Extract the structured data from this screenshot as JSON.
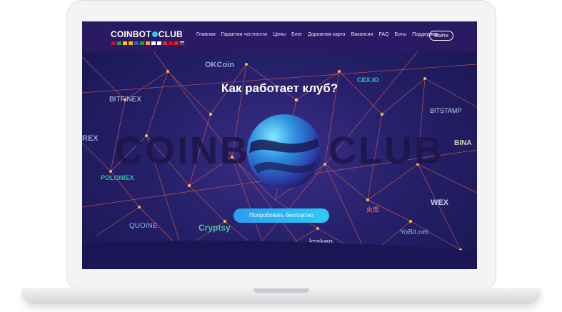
{
  "brand": {
    "logo_left": "COINBOT",
    "logo_right": "CLUB"
  },
  "languages": [
    {
      "name": "uk",
      "color": "#c8102e"
    },
    {
      "name": "br",
      "color": "#2d9b3a"
    },
    {
      "name": "de",
      "color": "#ffce00"
    },
    {
      "name": "es",
      "color": "#f1bf00"
    },
    {
      "name": "fr",
      "color": "#2d63c8"
    },
    {
      "name": "it",
      "color": "#2d9b3a"
    },
    {
      "name": "in",
      "color": "#ff9933"
    },
    {
      "name": "kr",
      "color": "#ffffff"
    },
    {
      "name": "jp",
      "color": "#ffffff"
    },
    {
      "name": "pt",
      "color": "#d62d2d"
    },
    {
      "name": "tr",
      "color": "#e30a17"
    },
    {
      "name": "cn",
      "color": "#de2910"
    },
    {
      "name": "ru",
      "color": "#ffffff"
    }
  ],
  "nav": {
    "items": [
      "Главная",
      "Гарантия честности",
      "Цены",
      "Блог",
      "Дорожная карта",
      "Вакансии",
      "FAQ",
      "Боты",
      "Поддержка"
    ],
    "login": "Войти"
  },
  "hero": {
    "title": "Как работает клуб?",
    "watermark_left": "COINB",
    "watermark_right": "CLUB",
    "cta": "Попробовать бесплатно"
  },
  "exchanges": {
    "okcoin": "OKCoin",
    "cex": "CEX.IO",
    "bitfinex": "BITFINEX",
    "bitstamp": "BITSTAMP",
    "bittrex": "REX",
    "binance": "BINA",
    "poloniex": "POLONIEX",
    "wex": "WEX",
    "huobi": "火币",
    "quoine": "QUOINE",
    "cryptsy": "Cryptsy",
    "yobit": "YoBit.net",
    "kraken": "kraken"
  },
  "colors": {
    "navbar": "#2a1a63",
    "accent": "#31c9f5",
    "network_line": "#e9664f",
    "network_node": "#ffb14a"
  }
}
